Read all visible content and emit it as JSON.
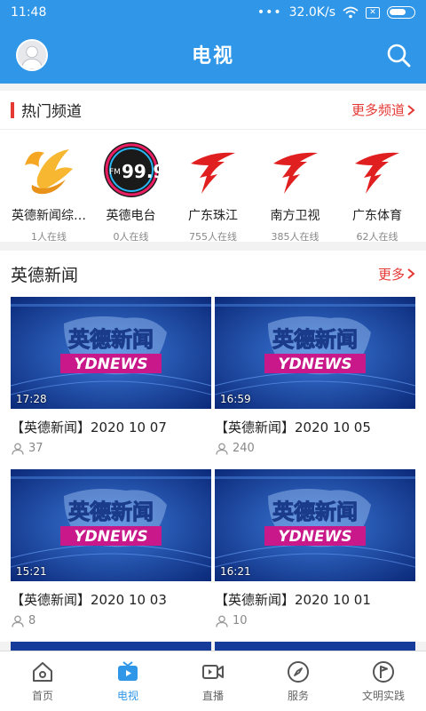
{
  "status": {
    "time": "11:48",
    "dots": "•••",
    "speed": "32.0K/s"
  },
  "appbar": {
    "title": "电视"
  },
  "hot": {
    "title": "热门频道",
    "more": "更多频道",
    "channels": [
      {
        "name": "英德新闻综…",
        "online": "1人在线"
      },
      {
        "name": "英德电台",
        "online": "0人在线",
        "fm": "FM",
        "freq": "99.9"
      },
      {
        "name": "广东珠江",
        "online": "755人在线"
      },
      {
        "name": "南方卫视",
        "online": "385人在线"
      },
      {
        "name": "广东体育",
        "online": "62人在线"
      }
    ]
  },
  "news": {
    "title": "英德新闻",
    "more": "更多",
    "thumb_cn": "英德新闻",
    "thumb_en": "YDNEWS",
    "items": [
      {
        "title": "【英德新闻】2020 10 07",
        "views": "37",
        "duration": "17:28"
      },
      {
        "title": "【英德新闻】2020 10 05",
        "views": "240",
        "duration": "16:59"
      },
      {
        "title": "【英德新闻】2020 10 03",
        "views": "8",
        "duration": "15:21"
      },
      {
        "title": "【英德新闻】2020 10 01",
        "views": "10",
        "duration": "16:21"
      }
    ]
  },
  "tabs": [
    {
      "label": "首页",
      "icon": "home-icon"
    },
    {
      "label": "电视",
      "icon": "tv-icon",
      "active": true
    },
    {
      "label": "直播",
      "icon": "video-camera-icon"
    },
    {
      "label": "服务",
      "icon": "compass-icon"
    },
    {
      "label": "文明实践",
      "icon": "flag-icon"
    }
  ],
  "colors": {
    "primary": "#2f96e8",
    "accent": "#e53935"
  }
}
